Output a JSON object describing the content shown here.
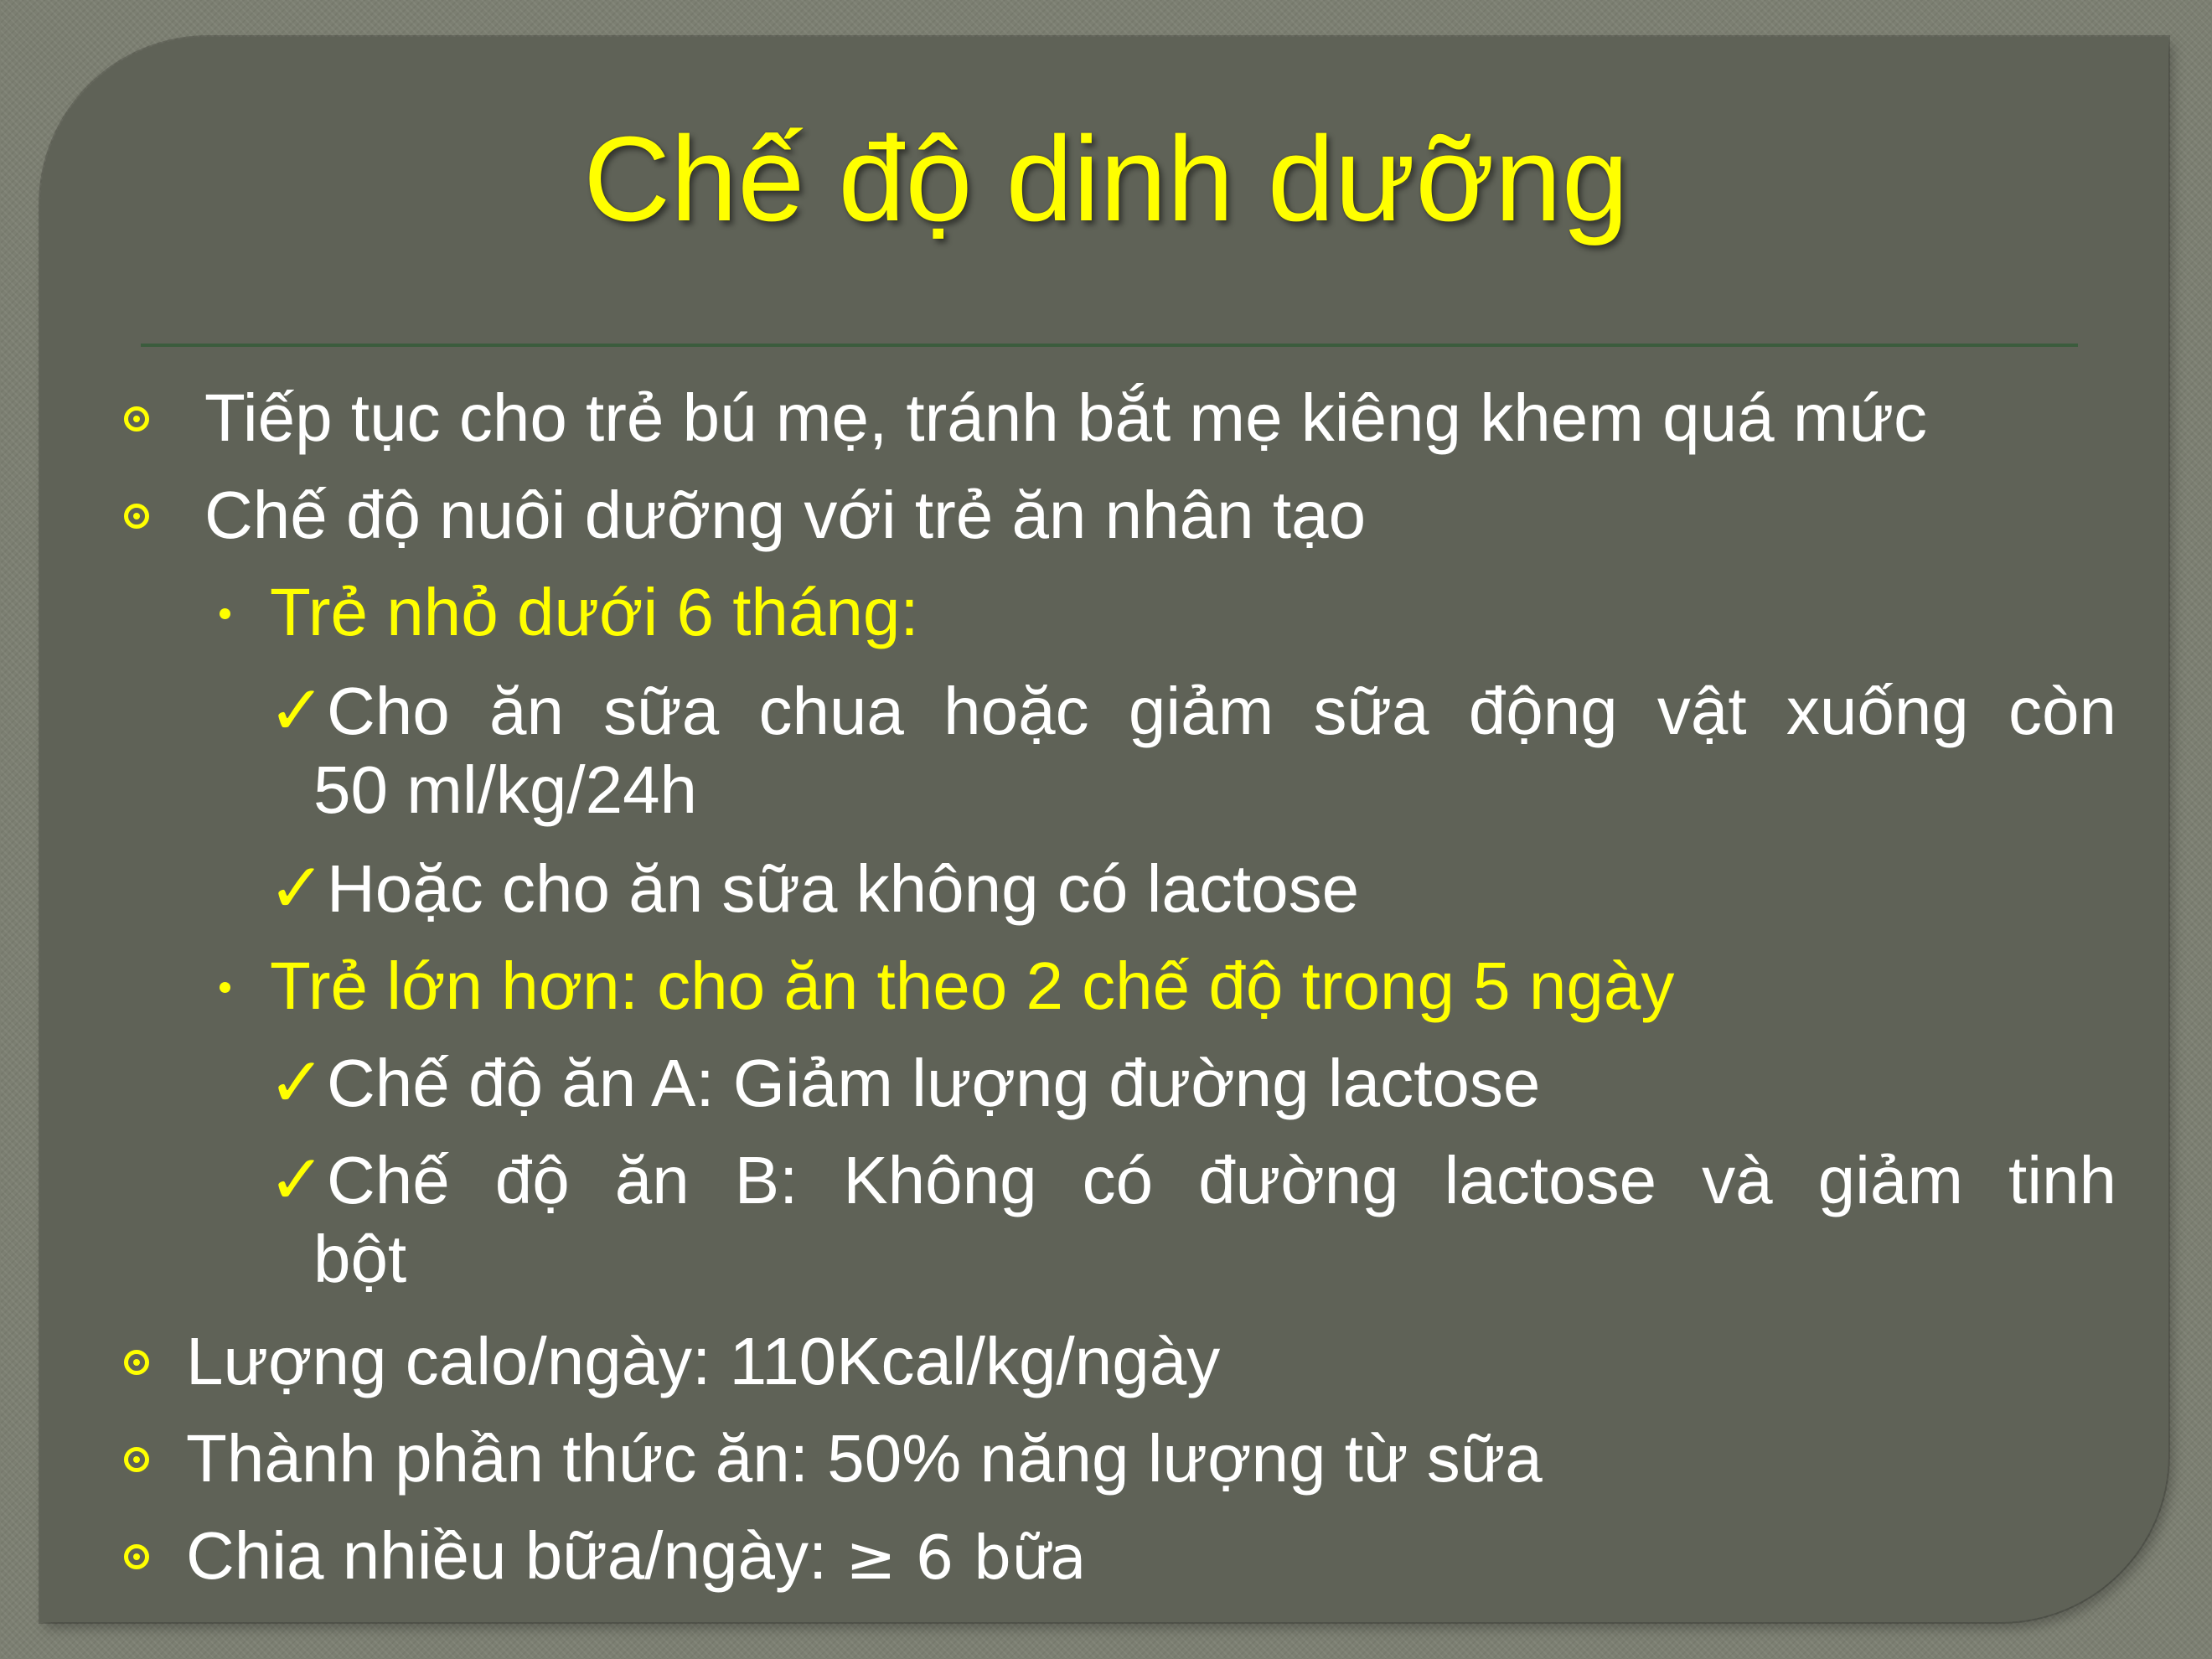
{
  "slide": {
    "title": "Chế độ dinh dưỡng",
    "items": [
      {
        "text": "Tiếp tục cho trẻ bú mẹ, tránh bắt mẹ kiêng khem quá mức",
        "icon": "target-bullet-icon"
      },
      {
        "text": "Chế độ nuôi dưỡng với trẻ ăn nhân tạo",
        "icon": "target-bullet-icon"
      },
      {
        "text": "Trẻ nhỏ dưới 6 tháng:",
        "icon": "dot-bullet-icon",
        "color": "#ffff00"
      },
      {
        "text_line1": "Cho ăn sữa chua hoặc giảm sữa động vật xuống còn",
        "text_line2": "50 ml/kg/24h",
        "icon": "checkmark-icon",
        "check_glyph": "✓"
      },
      {
        "text": "Hoặc cho ăn sữa không có lactose",
        "icon": "checkmark-icon",
        "check_glyph": "✓"
      },
      {
        "text": "Trẻ lớn hơn: cho ăn theo 2 chế độ trong 5 ngày",
        "icon": "dot-bullet-icon",
        "color": "#ffff00"
      },
      {
        "text": "Chế độ ăn A: Giảm lượng đường lactose",
        "icon": "checkmark-icon",
        "check_glyph": "✓"
      },
      {
        "text_line1": "Chế độ ăn B: Không có đường lactose và giảm tinh",
        "text_line2": "bột",
        "icon": "checkmark-icon",
        "check_glyph": "✓"
      },
      {
        "text": "Lượng calo/ngày: 110Kcal/kg/ngày",
        "icon": "target-bullet-icon"
      },
      {
        "text": "Thành phần thức ăn: 50% năng lượng từ sữa",
        "icon": "target-bullet-icon"
      },
      {
        "text_main": "Chia nhiều bữa/ngày: ",
        "text_tail": "≥ 6 bữa",
        "icon": "target-bullet-icon"
      }
    ]
  },
  "colors": {
    "accent": "#ffff00",
    "text": "#ffffff",
    "panel": "#5f6257",
    "background": "#7c7f72",
    "divider": "#355c38"
  }
}
